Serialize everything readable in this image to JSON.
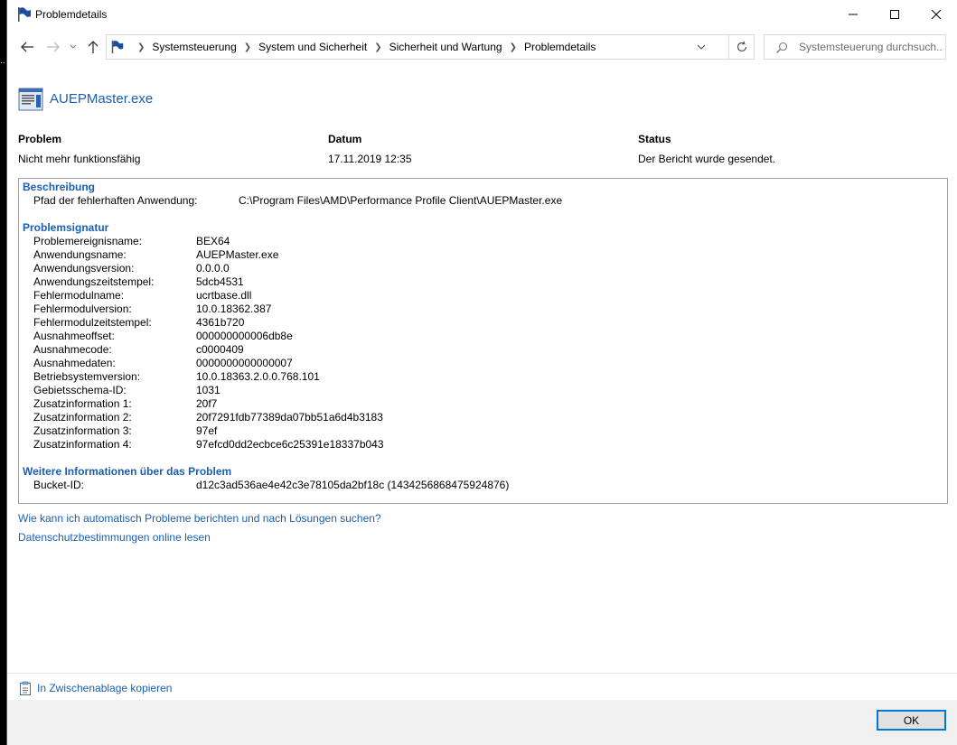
{
  "window": {
    "title": "Problemdetails"
  },
  "nav": {
    "breadcrumbs": [
      "Systemsteuerung",
      "System und Sicherheit",
      "Sicherheit und Wartung",
      "Problemdetails"
    ],
    "search_placeholder": "Systemsteuerung durchsuch..."
  },
  "app": {
    "name": "AUEPMaster.exe"
  },
  "summary": {
    "headers": {
      "problem": "Problem",
      "date": "Datum",
      "status": "Status"
    },
    "problem": "Nicht mehr funktionsfähig",
    "date": "17.11.2019 12:35",
    "status": "Der Bericht wurde gesendet."
  },
  "description": {
    "heading": "Beschreibung",
    "label": "Pfad der fehlerhaften Anwendung:",
    "value": "C:\\Program Files\\AMD\\Performance Profile Client\\AUEPMaster.exe"
  },
  "signature": {
    "heading": "Problemsignatur",
    "rows": [
      {
        "key": "Problemereignisname:",
        "value": "BEX64"
      },
      {
        "key": "Anwendungsname:",
        "value": "AUEPMaster.exe"
      },
      {
        "key": "Anwendungsversion:",
        "value": "0.0.0.0"
      },
      {
        "key": "Anwendungszeitstempel:",
        "value": "5dcb4531"
      },
      {
        "key": "Fehlermodulname:",
        "value": "ucrtbase.dll"
      },
      {
        "key": "Fehlermodulversion:",
        "value": "10.0.18362.387"
      },
      {
        "key": "Fehlermodulzeitstempel:",
        "value": "4361b720"
      },
      {
        "key": "Ausnahmeoffset:",
        "value": "000000000006db8e"
      },
      {
        "key": "Ausnahmecode:",
        "value": "c0000409"
      },
      {
        "key": "Ausnahmedaten:",
        "value": "0000000000000007"
      },
      {
        "key": "Betriebsystemversion:",
        "value": "10.0.18363.2.0.0.768.101"
      },
      {
        "key": "Gebietsschema-ID:",
        "value": "1031"
      },
      {
        "key": "Zusatzinformation 1:",
        "value": "20f7"
      },
      {
        "key": "Zusatzinformation 2:",
        "value": "20f7291fdb77389da07bb51a6d4b3183"
      },
      {
        "key": "Zusatzinformation 3:",
        "value": "97ef"
      },
      {
        "key": "Zusatzinformation 4:",
        "value": "97efcd0dd2ecbce6c25391e18337b043"
      }
    ]
  },
  "more_info": {
    "heading": "Weitere Informationen über das Problem",
    "key": "Bucket-ID:",
    "value": "d12c3ad536ae4e42c3e78105da2bf18c (1434256868475924876)"
  },
  "links": {
    "auto_report": "Wie kann ich automatisch Probleme berichten und nach Lösungen suchen?",
    "privacy": "Datenschutzbestimmungen online lesen",
    "copy": "In Zwischenablage kopieren"
  },
  "footer": {
    "ok_label": "OK"
  },
  "colors": {
    "link": "#1a5fb4",
    "accent": "#0078d7"
  },
  "icons": [
    "flag-icon",
    "back-arrow-icon",
    "forward-arrow-icon",
    "up-arrow-icon",
    "chevron-down-icon",
    "refresh-icon",
    "search-icon",
    "report-window-icon",
    "clipboard-icon"
  ]
}
